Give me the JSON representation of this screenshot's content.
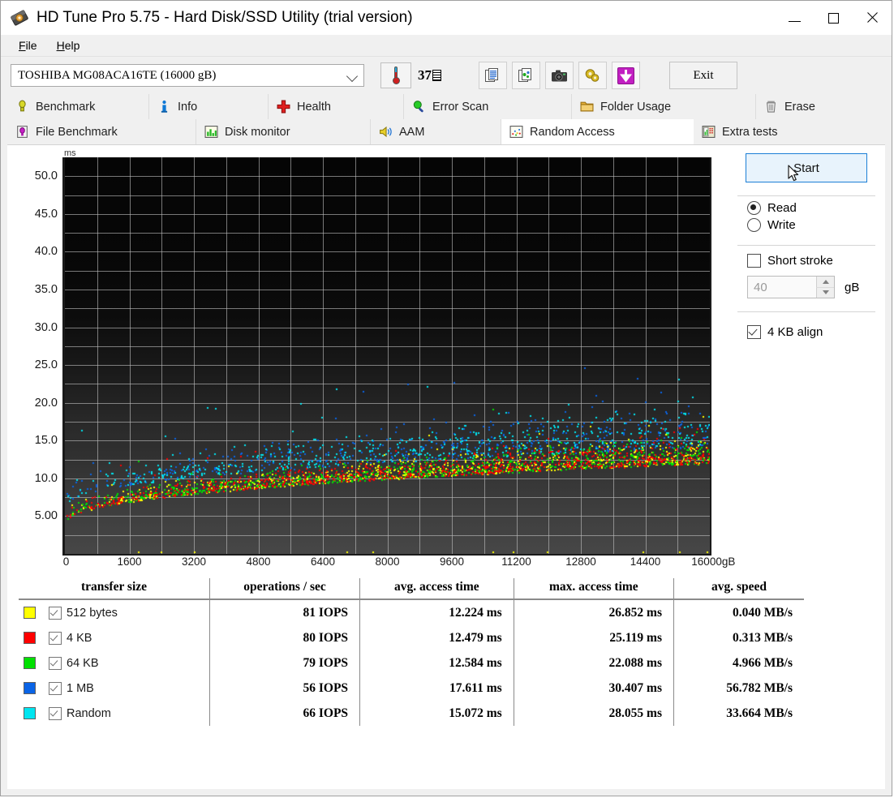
{
  "window": {
    "title": "HD Tune Pro 5.75 - Hard Disk/SSD Utility (trial version)",
    "app_icon": "hard-disk-icon",
    "minimize": "–",
    "maximize": "□",
    "close": "✕"
  },
  "menu": {
    "items": [
      {
        "label": "File",
        "accel": "F"
      },
      {
        "label": "Help",
        "accel": "H"
      }
    ]
  },
  "toolbar": {
    "drive_selected": "TOSHIBA MG08ACA16TE (16000 gB)",
    "drive_caret_icon": "chevron-down-icon",
    "temperature_icon": "thermometer-icon",
    "temperature_value": "37",
    "temperature_unit_glyph": "°C",
    "icons": [
      {
        "name": "copy-info-icon",
        "title": "Copy info"
      },
      {
        "name": "copy-graph-icon",
        "title": "Copy graph"
      },
      {
        "name": "screenshot-camera-icon",
        "title": "Screenshot"
      },
      {
        "name": "settings-gears-icon",
        "title": "Options"
      },
      {
        "name": "download-arrow-icon",
        "title": "Save"
      }
    ],
    "exit_label": "Exit"
  },
  "tabs": {
    "row1": [
      {
        "label": "Benchmark",
        "icon": "lightbulb-icon",
        "active": false
      },
      {
        "label": "Info",
        "icon": "info-icon",
        "active": false
      },
      {
        "label": "Health",
        "icon": "red-cross-icon",
        "active": false
      },
      {
        "label": "Error Scan",
        "icon": "magnifier-icon",
        "active": false
      },
      {
        "label": "Folder Usage",
        "icon": "folder-icon",
        "active": false
      },
      {
        "label": "Erase",
        "icon": "trash-icon",
        "active": false
      }
    ],
    "row2": [
      {
        "label": "File Benchmark",
        "icon": "file-bulb-icon",
        "active": false
      },
      {
        "label": "Disk monitor",
        "icon": "bar-chart-icon",
        "active": false
      },
      {
        "label": "AAM",
        "icon": "speaker-icon",
        "active": false
      },
      {
        "label": "Random Access",
        "icon": "scatter-dots-icon",
        "active": true
      },
      {
        "label": "Extra tests",
        "icon": "calculator-chart-icon",
        "active": false
      }
    ]
  },
  "sidepanel": {
    "start_label": "Start",
    "mode_read": "Read",
    "mode_write": "Write",
    "mode_selected": "Read",
    "short_stroke_label": "Short stroke",
    "short_stroke_checked": false,
    "short_stroke_value": "40",
    "short_stroke_unit": "gB",
    "align_label": "4 KB align",
    "align_checked": true,
    "cursor_icon": "mouse-pointer-icon"
  },
  "chart_data": {
    "type": "scatter",
    "title": "",
    "xlabel": "gB",
    "ylabel": "ms",
    "y_unit": "ms",
    "x_unit": "gB",
    "xlim": [
      0,
      16000
    ],
    "ylim": [
      0,
      52.5
    ],
    "xticks": [
      0,
      1600,
      3200,
      4800,
      6400,
      8000,
      9600,
      11200,
      12800,
      14400,
      16000
    ],
    "xticklabels": [
      "0",
      "1600",
      "3200",
      "4800",
      "6400",
      "8000",
      "9600",
      "11200",
      "12800",
      "14400",
      "16000"
    ],
    "yticks": [
      5,
      10,
      15,
      20,
      25,
      30,
      35,
      40,
      45,
      50
    ],
    "yticklabels": [
      "5.00",
      "10.0",
      "15.0",
      "20.0",
      "25.0",
      "30.0",
      "35.0",
      "40.0",
      "45.0",
      "50.0"
    ],
    "grid": true,
    "grid_x_step": 800,
    "grid_y_step": 2.5,
    "legend_position": "below-table",
    "background": "dark-gradient",
    "series": [
      {
        "name": "512 bytes",
        "color": "#ffff00",
        "points": 600
      },
      {
        "name": "4 KB",
        "color": "#ff0000",
        "points": 600
      },
      {
        "name": "64 KB",
        "color": "#00e000",
        "points": 600
      },
      {
        "name": "1 MB",
        "color": "#0a64e6",
        "points": 600
      },
      {
        "name": "Random",
        "color": "#00e5f0",
        "points": 600
      }
    ],
    "description": "Access time vs. disk position scatter; cloud rises from ~4 ms at 0 gB to ~14 ms near 16000 gB, with 1 MB/Random points scattered up to ~25 ms."
  },
  "results": {
    "headers": [
      "transfer size",
      "operations / sec",
      "avg. access time",
      "max. access time",
      "avg. speed"
    ],
    "rows": [
      {
        "color": "#ffff00",
        "checked": true,
        "transfer_size": "512 bytes",
        "ops": "81 IOPS",
        "avg_access": "12.224 ms",
        "max_access": "26.852 ms",
        "avg_speed": "0.040 MB/s"
      },
      {
        "color": "#ff0000",
        "checked": true,
        "transfer_size": "4 KB",
        "ops": "80 IOPS",
        "avg_access": "12.479 ms",
        "max_access": "25.119 ms",
        "avg_speed": "0.313 MB/s"
      },
      {
        "color": "#00e000",
        "checked": true,
        "transfer_size": "64 KB",
        "ops": "79 IOPS",
        "avg_access": "12.584 ms",
        "max_access": "22.088 ms",
        "avg_speed": "4.966 MB/s"
      },
      {
        "color": "#0a64e6",
        "checked": true,
        "transfer_size": "1 MB",
        "ops": "56 IOPS",
        "avg_access": "17.611 ms",
        "max_access": "30.407 ms",
        "avg_speed": "56.782 MB/s"
      },
      {
        "color": "#00e5f0",
        "checked": true,
        "transfer_size": "Random",
        "ops": "66 IOPS",
        "avg_access": "15.072 ms",
        "max_access": "28.055 ms",
        "avg_speed": "33.664 MB/s"
      }
    ]
  }
}
